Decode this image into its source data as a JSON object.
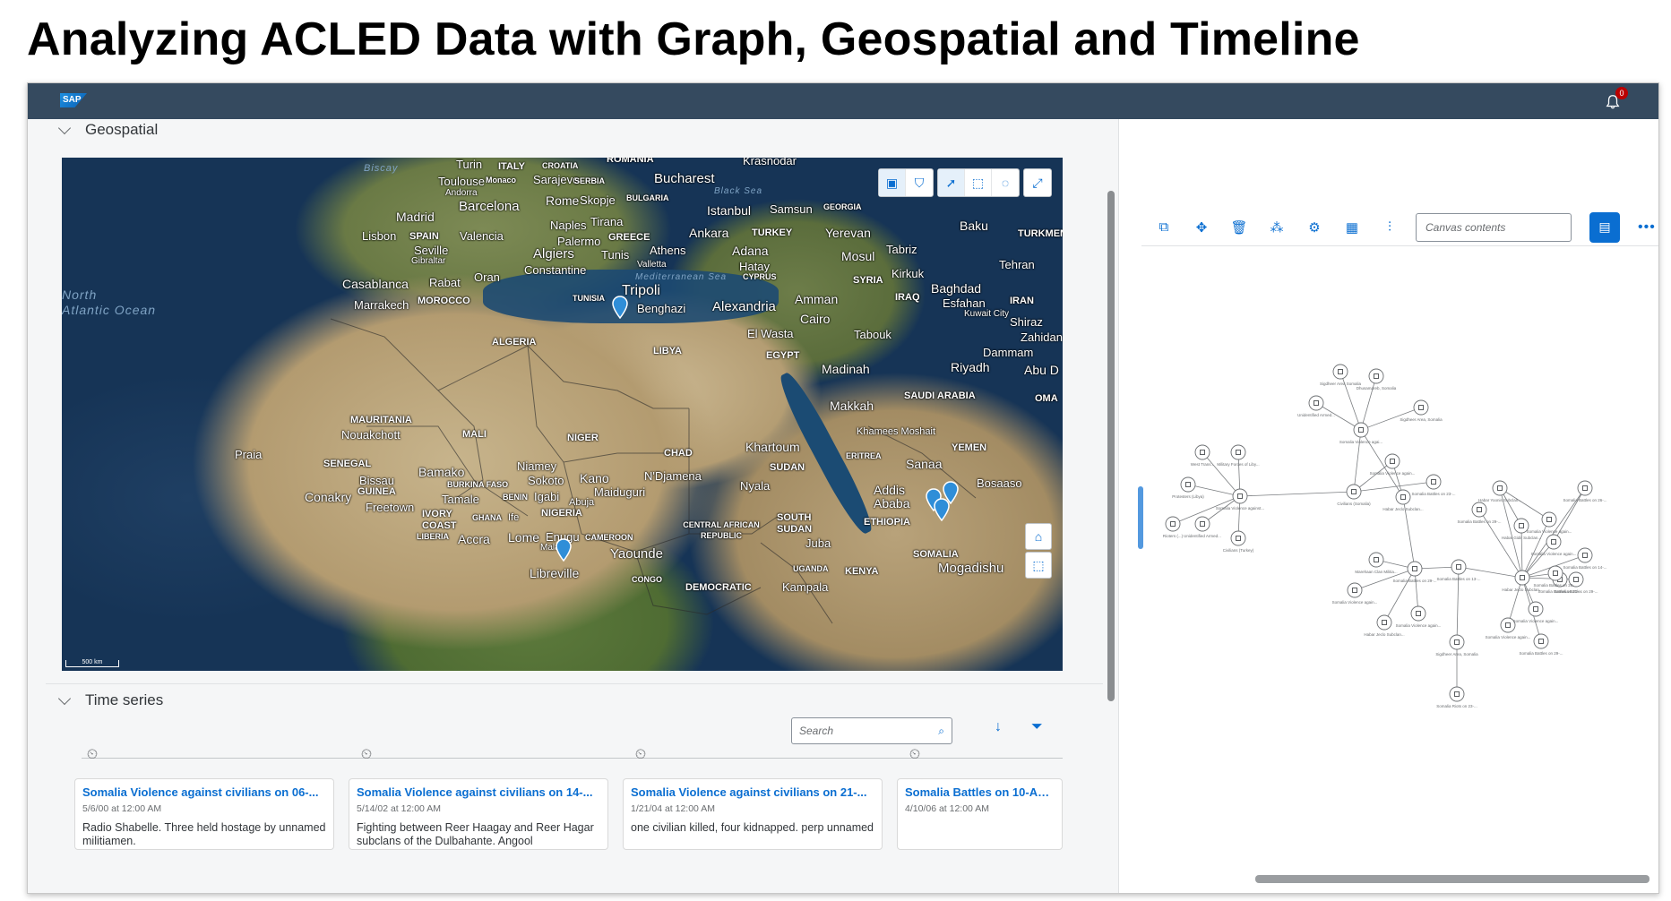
{
  "slide_title": "Analyzing ACLED Data with Graph, Geospatial and Timeline",
  "shellbar": {
    "logo": "SAP",
    "notification_icon": "bell-icon",
    "notification_count": "0"
  },
  "geospatial": {
    "section_label": "Geospatial",
    "map_labels": [
      {
        "text": "Turin"
      },
      {
        "text": "ITALY"
      },
      {
        "text": "CROATIA"
      },
      {
        "text": "ROMANIA"
      },
      {
        "text": "Krasnodar"
      },
      {
        "text": "Biscay"
      },
      {
        "text": "Toulouse"
      },
      {
        "text": "Monaco"
      },
      {
        "text": "Sarajevo"
      },
      {
        "text": "SERBIA"
      },
      {
        "text": "Bucharest"
      },
      {
        "text": "Andorra"
      },
      {
        "text": "Rome"
      },
      {
        "text": "Skopje"
      },
      {
        "text": "BULGARIA"
      },
      {
        "text": "Barcelona"
      },
      {
        "text": "Black Sea"
      },
      {
        "text": "Madrid"
      },
      {
        "text": "Istanbul"
      },
      {
        "text": "Samsun"
      },
      {
        "text": "GEORGIA"
      },
      {
        "text": "Naples"
      },
      {
        "text": "Tirana"
      },
      {
        "text": "Lisbon"
      },
      {
        "text": "SPAIN"
      },
      {
        "text": "Valencia"
      },
      {
        "text": "Palermo"
      },
      {
        "text": "GREECE"
      },
      {
        "text": "Ankara"
      },
      {
        "text": "TURKEY"
      },
      {
        "text": "Yerevan"
      },
      {
        "text": "Baku"
      },
      {
        "text": "TURKMEN"
      },
      {
        "text": "Seville"
      },
      {
        "text": "Athens"
      },
      {
        "text": "Tabriz"
      },
      {
        "text": "Gibraltar"
      },
      {
        "text": "Algiers"
      },
      {
        "text": "Tunis"
      },
      {
        "text": "Adana"
      },
      {
        "text": "Mosul"
      },
      {
        "text": "Oran"
      },
      {
        "text": "Constantine"
      },
      {
        "text": "Valletta"
      },
      {
        "text": "Hatay"
      },
      {
        "text": "Tehran"
      },
      {
        "text": "Rabat"
      },
      {
        "text": "Mediterranean Sea"
      },
      {
        "text": "CYPRUS"
      },
      {
        "text": "Kirkuk"
      },
      {
        "text": "Casablanca"
      },
      {
        "text": "TUNISIA"
      },
      {
        "text": "Tripoli"
      },
      {
        "text": "SYRIA"
      },
      {
        "text": "Baghdad"
      },
      {
        "text": "North"
      },
      {
        "text": "Atlantic Ocean"
      },
      {
        "text": "Marrakech"
      },
      {
        "text": "MOROCCO"
      },
      {
        "text": "Benghazi"
      },
      {
        "text": "Alexandria"
      },
      {
        "text": "Amman"
      },
      {
        "text": "IRAQ"
      },
      {
        "text": "Esfahan"
      },
      {
        "text": "IRAN"
      },
      {
        "text": "Cairo"
      },
      {
        "text": "Kuwait City"
      },
      {
        "text": "Shiraz"
      },
      {
        "text": "El Wasta"
      },
      {
        "text": "Tabouk"
      },
      {
        "text": "Zahidan"
      },
      {
        "text": "ALGERIA"
      },
      {
        "text": "LIBYA"
      },
      {
        "text": "Dammam"
      },
      {
        "text": "EGYPT"
      },
      {
        "text": "Riyadh"
      },
      {
        "text": "Abu D"
      },
      {
        "text": "Madinah"
      },
      {
        "text": "SAUDI ARABIA"
      },
      {
        "text": "OMA"
      },
      {
        "text": "Makkah"
      },
      {
        "text": "MAURITANIA"
      },
      {
        "text": "Nouakchott"
      },
      {
        "text": "MALI"
      },
      {
        "text": "NIGER"
      },
      {
        "text": "Khamees Moshait"
      },
      {
        "text": "Praia"
      },
      {
        "text": "Khartoum"
      },
      {
        "text": "YEMEN"
      },
      {
        "text": "CHAD"
      },
      {
        "text": "ERITREA"
      },
      {
        "text": "SENEGAL"
      },
      {
        "text": "Niamey"
      },
      {
        "text": "Sanaa"
      },
      {
        "text": "Bamako"
      },
      {
        "text": "SUDAN"
      },
      {
        "text": "Bissau"
      },
      {
        "text": "BURKINA FASO"
      },
      {
        "text": "Sokoto"
      },
      {
        "text": "Kano"
      },
      {
        "text": "N'Djamena"
      },
      {
        "text": "Bosaaso"
      },
      {
        "text": "GUINEA"
      },
      {
        "text": "Nyala"
      },
      {
        "text": "Addis Ababa"
      },
      {
        "text": "Conakry"
      },
      {
        "text": "Maiduguri"
      },
      {
        "text": "Freetown"
      },
      {
        "text": "Tamale"
      },
      {
        "text": "BENIN"
      },
      {
        "text": "Igabi"
      },
      {
        "text": "Abuja"
      },
      {
        "text": "IVORY COAST"
      },
      {
        "text": "GHANA"
      },
      {
        "text": "Ife"
      },
      {
        "text": "NIGERIA"
      },
      {
        "text": "CENTRAL AFRICAN REPUBLIC"
      },
      {
        "text": "SOUTH SUDAN"
      },
      {
        "text": "ETHIOPIA"
      },
      {
        "text": "LIBERIA"
      },
      {
        "text": "Accra"
      },
      {
        "text": "Lome"
      },
      {
        "text": "Enugu"
      },
      {
        "text": "CAMEROON"
      },
      {
        "text": "Juba"
      },
      {
        "text": "Malabo"
      },
      {
        "text": "Yaounde"
      },
      {
        "text": "SOMALIA"
      },
      {
        "text": "Mogadishu"
      },
      {
        "text": "Libreville"
      },
      {
        "text": "UGANDA"
      },
      {
        "text": "KENYA"
      },
      {
        "text": "CONGO"
      },
      {
        "text": "DEMOCRATIC"
      },
      {
        "text": "Kampala"
      },
      {
        "text": "500 km"
      }
    ],
    "toolbar_icons": [
      "legend-icon",
      "layers-icon",
      "select-icon",
      "rectangle-select-icon",
      "lasso-select-icon",
      "fullscreen-icon"
    ],
    "side_icons": [
      "home-icon",
      "zoom-extent-icon"
    ]
  },
  "timeseries": {
    "section_label": "Time series",
    "search_placeholder": "Search",
    "sort_icon": "sort-descending-icon",
    "filter_icon": "filter-icon",
    "cards": [
      {
        "title": "Somalia Violence against civilians on 06-...",
        "date": "5/6/00 at 12:00 AM",
        "text": "Radio Shabelle. Three held hostage by unnamed militiamen."
      },
      {
        "title": "Somalia Violence against civilians on 14-...",
        "date": "5/14/02 at 12:00 AM",
        "text": "Fighting between Reer Haagay and Reer Hagar subclans of the Dulbahante. Angool"
      },
      {
        "title": "Somalia Violence against civilians on 21-...",
        "date": "1/21/04 at 12:00 AM",
        "text": "one civilian killed, four kidnapped. perp unnamed"
      },
      {
        "title": "Somalia Battles on 10-April-",
        "date": "4/10/06 at 12:00 AM",
        "text": ""
      }
    ]
  },
  "graph_panel": {
    "canvas_placeholder": "Canvas contents",
    "toolbar_icons": [
      "copy-icon",
      "move-icon",
      "delete-icon",
      "layout-icon",
      "settings-icon",
      "grid-icon",
      "filter-settings-icon"
    ],
    "primary_icon": "details-panel-icon",
    "more_icon": "overflow-icon",
    "node_labels": [
      "Sigdheer Area Somalia",
      "Dhusamareb, Somalia",
      "Unidentified Armed...",
      "Somalia Violence agai...",
      "Sigdheer Area, Somalia",
      "Somalia Violence again...",
      "Civilians (Somalia)",
      "Habar Jeclo Subclan...",
      "Somalia Battles on 23-...",
      "Habar Yoonis Subclan...",
      "Somalia Battles on 29-...",
      "Habar Gidir Subclan...",
      "West Trans...",
      "Military Forces of Liby...",
      "Protesters (Libya)",
      "Somalia Violence against...",
      "Unidentified Armed...",
      "Civilians (Turkey)",
      "Rioters (...)",
      "Somalia Battles on 26-...",
      "Somalia Violence again...",
      "Somalia Violence again...",
      "Marehaan Clan Militia...",
      "Somalia Battles on 29-...",
      "Somalia Battles on 13-...",
      "Habar Jeclo Subclan...",
      "Somalia Battles on 21-...",
      "Sigdheer Area, Somalia",
      "Somalia Violence again...",
      "Habar Jeclo Subclan...",
      "Somalia Violence again...",
      "Somalia Battles on 14-...",
      "Somalia Battles on 29-...",
      "Somalia Battles on 28-...",
      "Somalia Violence again...",
      "Somalia Violence again...",
      "Somalia Battles on 29-...",
      "Somalia Riots on 23-..."
    ]
  }
}
